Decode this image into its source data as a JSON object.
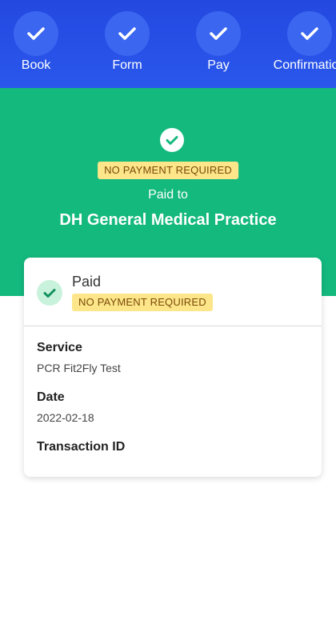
{
  "stepper": {
    "steps": [
      {
        "label": "Book",
        "icon": "check-icon"
      },
      {
        "label": "Form",
        "icon": "check-icon"
      },
      {
        "label": "Pay",
        "icon": "check-icon"
      },
      {
        "label": "Confirmation",
        "icon": "check-icon"
      }
    ]
  },
  "hero": {
    "icon": "check-circle-icon",
    "badge": "NO PAYMENT REQUIRED",
    "paid_to_label": "Paid to",
    "practice_name": "DH General Medical Practice"
  },
  "card": {
    "status_icon": "check-icon",
    "status": "Paid",
    "badge": "NO PAYMENT REQUIRED",
    "fields": [
      {
        "label": "Service",
        "value": "PCR Fit2Fly Test"
      },
      {
        "label": "Date",
        "value": "2022-02-18"
      },
      {
        "label": "Transaction ID",
        "value": ""
      }
    ]
  },
  "colors": {
    "stepper_bg": "#2348e0",
    "hero_bg": "#14b97e",
    "badge_bg": "#fde68a",
    "badge_text": "#7a4a08"
  }
}
